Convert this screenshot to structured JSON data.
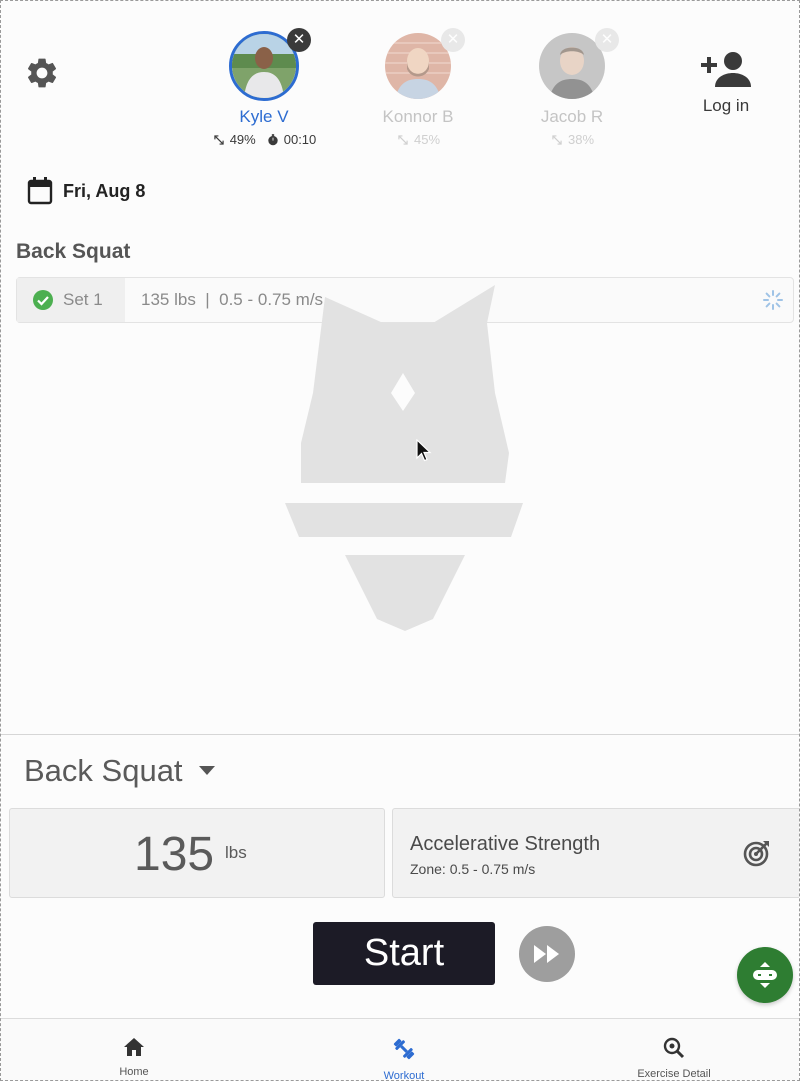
{
  "colors": {
    "accent": "#2d6cd1",
    "start_bg": "#1c1b26",
    "fab": "#2e7d32",
    "check": "#4caf50"
  },
  "header": {
    "settings_icon": "gear-icon",
    "athletes": [
      {
        "name": "Kyle V",
        "range": "49%",
        "timer": "00:10",
        "state": "active"
      },
      {
        "name": "Konnor B",
        "range": "45%",
        "state": "inactive"
      },
      {
        "name": "Jacob R",
        "range": "38%",
        "state": "inactive"
      }
    ],
    "login_label": "Log in"
  },
  "date": {
    "label": "Fri, Aug 8"
  },
  "workout": {
    "exercise": "Back Squat",
    "sets": [
      {
        "label": "Set 1",
        "info": "135 lbs  |  0.5 - 0.75 m/s",
        "status": "complete"
      }
    ]
  },
  "controls": {
    "exercise_select": "Back Squat",
    "weight_value": "135",
    "weight_unit": "lbs",
    "zone_title": "Accelerative Strength",
    "zone_subtitle": "Zone: 0.5 - 0.75 m/s",
    "start_label": "Start"
  },
  "bottom_nav": [
    {
      "label": "Home",
      "icon": "home-icon"
    },
    {
      "label": "Workout",
      "icon": "dumbbell-icon",
      "active": true
    },
    {
      "label": "Exercise Detail",
      "icon": "search-detail-icon"
    }
  ]
}
